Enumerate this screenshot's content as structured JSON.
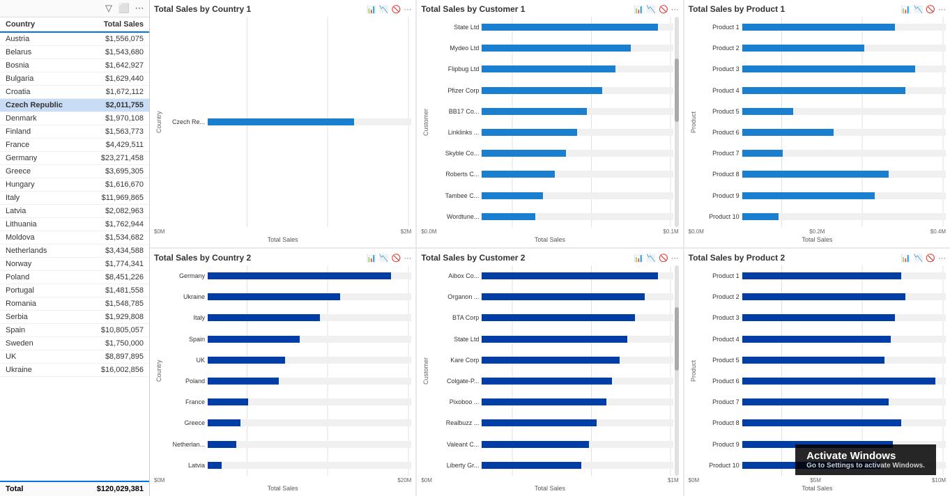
{
  "leftPanel": {
    "toolbar": {
      "filterIcon": "▽",
      "expandIcon": "⬜",
      "moreIcon": "⋯"
    },
    "title": "Country Total Sales",
    "columns": {
      "country": "Country",
      "sales": "Total Sales"
    },
    "rows": [
      {
        "country": "Austria",
        "sales": "$1,556,075",
        "highlighted": false
      },
      {
        "country": "Belarus",
        "sales": "$1,543,680",
        "highlighted": false
      },
      {
        "country": "Bosnia",
        "sales": "$1,642,927",
        "highlighted": false
      },
      {
        "country": "Bulgaria",
        "sales": "$1,629,440",
        "highlighted": false
      },
      {
        "country": "Croatia",
        "sales": "$1,672,112",
        "highlighted": false
      },
      {
        "country": "Czech Republic",
        "sales": "$2,011,755",
        "highlighted": true
      },
      {
        "country": "Denmark",
        "sales": "$1,970,108",
        "highlighted": false
      },
      {
        "country": "Finland",
        "sales": "$1,563,773",
        "highlighted": false
      },
      {
        "country": "France",
        "sales": "$4,429,511",
        "highlighted": false
      },
      {
        "country": "Germany",
        "sales": "$23,271,458",
        "highlighted": false
      },
      {
        "country": "Greece",
        "sales": "$3,695,305",
        "highlighted": false
      },
      {
        "country": "Hungary",
        "sales": "$1,616,670",
        "highlighted": false
      },
      {
        "country": "Italy",
        "sales": "$11,969,865",
        "highlighted": false
      },
      {
        "country": "Latvia",
        "sales": "$2,082,963",
        "highlighted": false
      },
      {
        "country": "Lithuania",
        "sales": "$1,762,944",
        "highlighted": false
      },
      {
        "country": "Moldova",
        "sales": "$1,534,682",
        "highlighted": false
      },
      {
        "country": "Netherlands",
        "sales": "$3,434,588",
        "highlighted": false
      },
      {
        "country": "Norway",
        "sales": "$1,774,341",
        "highlighted": false
      },
      {
        "country": "Poland",
        "sales": "$8,451,226",
        "highlighted": false
      },
      {
        "country": "Portugal",
        "sales": "$1,481,558",
        "highlighted": false
      },
      {
        "country": "Romania",
        "sales": "$1,548,785",
        "highlighted": false
      },
      {
        "country": "Serbia",
        "sales": "$1,929,808",
        "highlighted": false
      },
      {
        "country": "Spain",
        "sales": "$10,805,057",
        "highlighted": false
      },
      {
        "country": "Sweden",
        "sales": "$1,750,000",
        "highlighted": false
      },
      {
        "country": "UK",
        "sales": "$8,897,895",
        "highlighted": false
      },
      {
        "country": "Ukraine",
        "sales": "$16,002,856",
        "highlighted": false
      }
    ],
    "footer": {
      "label": "Total",
      "value": "$120,029,381"
    }
  },
  "charts": {
    "topRow": [
      {
        "id": "country1",
        "title": "Total Sales by Country 1",
        "yAxisLabel": "Country",
        "xAxisLabel": "Total Sales",
        "xAxisTicks": [
          "$0M",
          "$2M"
        ],
        "bars": [
          {
            "label": "Czech Re...",
            "pct": 72,
            "dark": false
          }
        ]
      },
      {
        "id": "customer1",
        "title": "Total Sales by Customer 1",
        "yAxisLabel": "Customer",
        "xAxisLabel": "Total Sales",
        "xAxisTicks": [
          "$0.0M",
          "$0.1M"
        ],
        "bars": [
          {
            "label": "State Ltd",
            "pct": 92,
            "dark": false
          },
          {
            "label": "Mydeo Ltd",
            "pct": 78,
            "dark": false
          },
          {
            "label": "Flipbug Ltd",
            "pct": 70,
            "dark": false
          },
          {
            "label": "Pfizer Corp",
            "pct": 63,
            "dark": false
          },
          {
            "label": "BB17 Co...",
            "pct": 55,
            "dark": false
          },
          {
            "label": "Linklinks ...",
            "pct": 50,
            "dark": false
          },
          {
            "label": "Skyble Co...",
            "pct": 44,
            "dark": false
          },
          {
            "label": "Roberts C...",
            "pct": 38,
            "dark": false
          },
          {
            "label": "Tambee C...",
            "pct": 32,
            "dark": false
          },
          {
            "label": "Wordtune...",
            "pct": 28,
            "dark": false
          }
        ]
      },
      {
        "id": "product1",
        "title": "Total Sales by Product 1",
        "yAxisLabel": "Product",
        "xAxisLabel": "Total Sales",
        "xAxisTicks": [
          "$0.0M",
          "$0.2M",
          "$0.4M"
        ],
        "bars": [
          {
            "label": "Product 1",
            "pct": 75,
            "dark": false
          },
          {
            "label": "Product 2",
            "pct": 60,
            "dark": false
          },
          {
            "label": "Product 3",
            "pct": 85,
            "dark": false
          },
          {
            "label": "Product 4",
            "pct": 80,
            "dark": false
          },
          {
            "label": "Product 5",
            "pct": 25,
            "dark": false
          },
          {
            "label": "Product 6",
            "pct": 45,
            "dark": false
          },
          {
            "label": "Product 7",
            "pct": 20,
            "dark": false
          },
          {
            "label": "Product 8",
            "pct": 72,
            "dark": false
          },
          {
            "label": "Product 9",
            "pct": 65,
            "dark": false
          },
          {
            "label": "Product 10",
            "pct": 18,
            "dark": false
          }
        ]
      }
    ],
    "bottomRow": [
      {
        "id": "country2",
        "title": "Total Sales by Country 2",
        "yAxisLabel": "Country",
        "xAxisLabel": "Total Sales",
        "xAxisTicks": [
          "$0M",
          "$20M"
        ],
        "bars": [
          {
            "label": "Germany",
            "pct": 90,
            "dark": true
          },
          {
            "label": "Ukraine",
            "pct": 65,
            "dark": true
          },
          {
            "label": "Italy",
            "pct": 55,
            "dark": true
          },
          {
            "label": "Spain",
            "pct": 45,
            "dark": true
          },
          {
            "label": "UK",
            "pct": 38,
            "dark": true
          },
          {
            "label": "Poland",
            "pct": 35,
            "dark": true
          },
          {
            "label": "France",
            "pct": 20,
            "dark": true
          },
          {
            "label": "Greece",
            "pct": 16,
            "dark": true
          },
          {
            "label": "Netherlan...",
            "pct": 14,
            "dark": true
          },
          {
            "label": "Latvia",
            "pct": 7,
            "dark": true
          }
        ]
      },
      {
        "id": "customer2",
        "title": "Total Sales by Customer 2",
        "yAxisLabel": "Customer",
        "xAxisLabel": "Total Sales",
        "xAxisTicks": [
          "$0M",
          "$1M"
        ],
        "bars": [
          {
            "label": "Aibox Co...",
            "pct": 92,
            "dark": true
          },
          {
            "label": "Organon ...",
            "pct": 85,
            "dark": true
          },
          {
            "label": "BTA Corp",
            "pct": 80,
            "dark": true
          },
          {
            "label": "State Ltd",
            "pct": 76,
            "dark": true
          },
          {
            "label": "Kare Corp",
            "pct": 72,
            "dark": true
          },
          {
            "label": "Colgate-P...",
            "pct": 68,
            "dark": true
          },
          {
            "label": "Pixoboo ...",
            "pct": 65,
            "dark": true
          },
          {
            "label": "Realbuzz ...",
            "pct": 60,
            "dark": true
          },
          {
            "label": "Valeant C...",
            "pct": 56,
            "dark": true
          },
          {
            "label": "Liberty Gr...",
            "pct": 52,
            "dark": true
          }
        ]
      },
      {
        "id": "product2",
        "title": "Total Sales by Product 2",
        "yAxisLabel": "Product",
        "xAxisLabel": "Total Sales",
        "xAxisTicks": [
          "$0M",
          "$5M",
          "$10M"
        ],
        "bars": [
          {
            "label": "Product 1",
            "pct": 78,
            "dark": true
          },
          {
            "label": "Product 2",
            "pct": 80,
            "dark": true
          },
          {
            "label": "Product 3",
            "pct": 75,
            "dark": true
          },
          {
            "label": "Product 4",
            "pct": 73,
            "dark": true
          },
          {
            "label": "Product 5",
            "pct": 70,
            "dark": true
          },
          {
            "label": "Product 6",
            "pct": 95,
            "dark": true
          },
          {
            "label": "Product 7",
            "pct": 72,
            "dark": true
          },
          {
            "label": "Product 8",
            "pct": 78,
            "dark": true
          },
          {
            "label": "Product 9",
            "pct": 74,
            "dark": true
          },
          {
            "label": "Product 10",
            "pct": 68,
            "dark": true
          }
        ]
      }
    ]
  },
  "windows": {
    "watermark": "Activate Windows",
    "subtext": "Go to Settings to activate Windows."
  }
}
